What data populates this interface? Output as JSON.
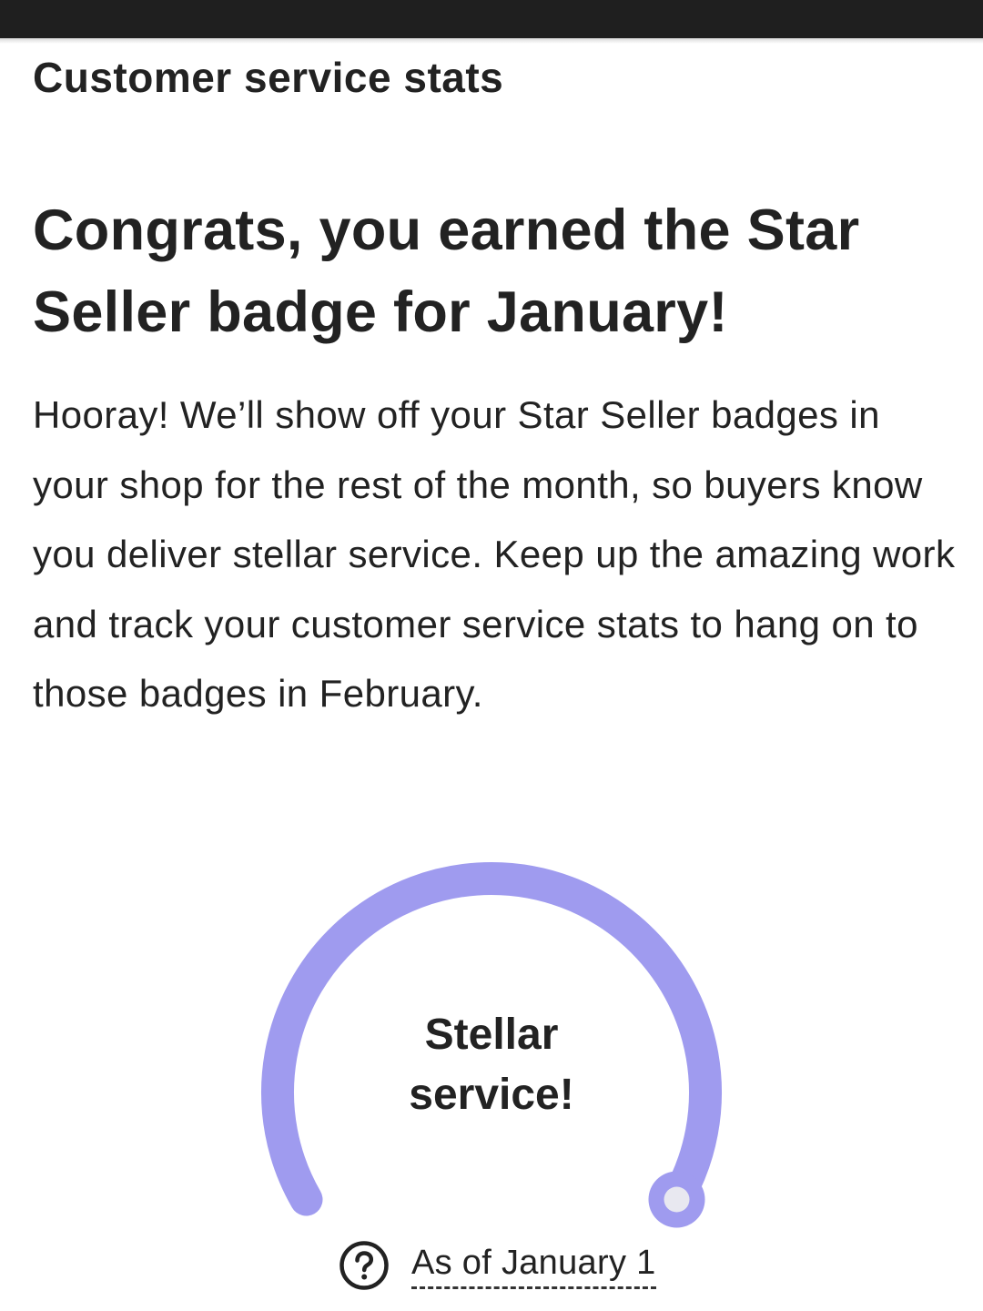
{
  "page": {
    "section_title": "Customer service stats",
    "headline": "Congrats, you earned the Star Seller badge for January!",
    "body": "Hooray! We’ll show off your Star Seller badges in your shop for the rest of the month, so buyers know you deliver stellar service. Keep up the amazing work and track your customer service stats to hang on to those badges in February."
  },
  "gauge": {
    "label_line1": "Stellar",
    "label_line2": "service!",
    "level_fraction": 1.0,
    "arc_color": "#9f9bef",
    "knob_color": "#e8e8f0"
  },
  "footer": {
    "help_icon": "question-circle-icon",
    "as_of_link": "As of January 1"
  },
  "colors": {
    "status_bar": "#1f1f1f",
    "text": "#222222"
  }
}
